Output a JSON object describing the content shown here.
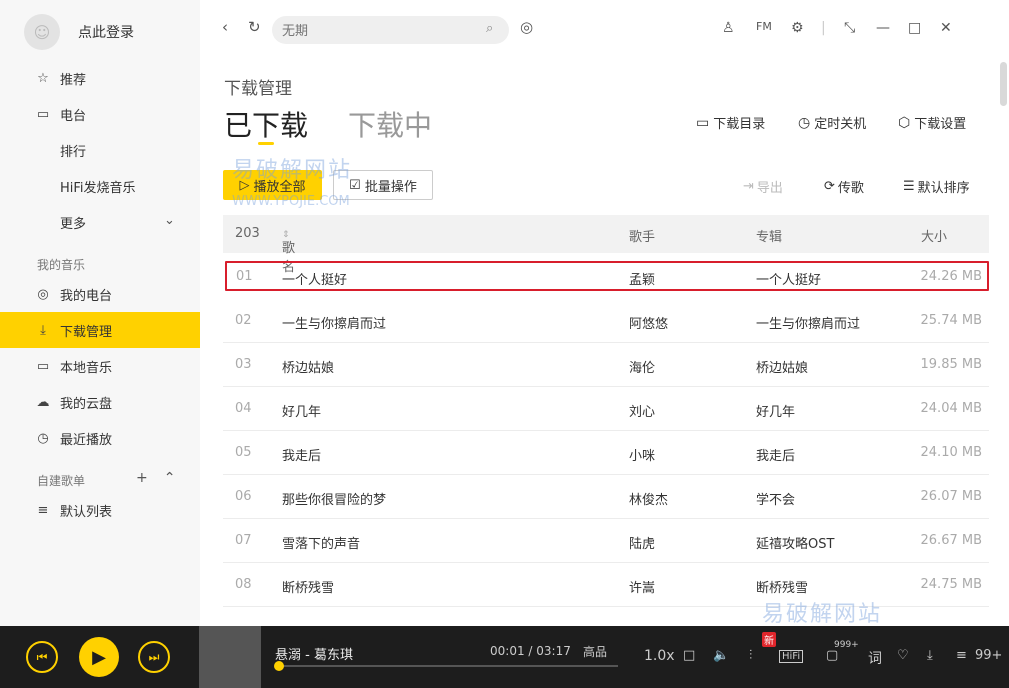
{
  "sidebar": {
    "login_label": "点此登录",
    "nav": [
      {
        "label": "推荐",
        "icon": "star-icon"
      },
      {
        "label": "电台",
        "icon": "radio-icon"
      },
      {
        "label": "排行"
      },
      {
        "label": "HiFi发烧音乐"
      },
      {
        "label": "更多"
      }
    ],
    "my_music_title": "我的音乐",
    "my_music": [
      {
        "label": "我的电台",
        "icon": "podcast-icon"
      },
      {
        "label": "下载管理",
        "icon": "download-icon",
        "active": true
      },
      {
        "label": "本地音乐",
        "icon": "monitor-icon"
      },
      {
        "label": "我的云盘",
        "icon": "cloud-icon"
      },
      {
        "label": "最近播放",
        "icon": "clock-icon"
      }
    ],
    "playlists_title": "自建歌单",
    "playlists": [
      {
        "label": "默认列表",
        "icon": "playlist-icon"
      }
    ]
  },
  "topbar": {
    "search_placeholder": "无期"
  },
  "page": {
    "breadcrumb": "下载管理",
    "tab_downloaded": "已下载",
    "tab_downloading": "下载中",
    "tool_dir": "下载目录",
    "tool_shutdown": "定时关机",
    "tool_settings": "下载设置",
    "play_all": "播放全部",
    "batch": "批量操作",
    "export": "导出",
    "transfer": "传歌",
    "sort": "默认排序"
  },
  "table": {
    "count": "203",
    "col_name": "歌名",
    "col_artist": "歌手",
    "col_album": "专辑",
    "col_size": "大小",
    "rows": [
      {
        "num": "01",
        "name": "一个人挺好",
        "artist": "孟颖",
        "album": "一个人挺好",
        "size": "24.26 MB"
      },
      {
        "num": "02",
        "name": "一生与你擦肩而过",
        "artist": "阿悠悠",
        "album": "一生与你擦肩而过",
        "size": "25.74 MB"
      },
      {
        "num": "03",
        "name": "桥边姑娘",
        "artist": "海伦",
        "album": "桥边姑娘",
        "size": "19.85 MB"
      },
      {
        "num": "04",
        "name": "好几年",
        "artist": "刘心",
        "album": "好几年",
        "size": "24.04 MB"
      },
      {
        "num": "05",
        "name": "我走后",
        "artist": "小咪",
        "album": "我走后",
        "size": "24.10 MB"
      },
      {
        "num": "06",
        "name": "那些你很冒险的梦",
        "artist": "林俊杰",
        "album": "学不会",
        "size": "26.07 MB"
      },
      {
        "num": "07",
        "name": "雪落下的声音",
        "artist": "陆虎",
        "album": "延禧攻略OST",
        "size": "26.67 MB"
      },
      {
        "num": "08",
        "name": "断桥残雪",
        "artist": "许嵩",
        "album": "断桥残雪",
        "size": "24.75 MB"
      }
    ]
  },
  "watermark": {
    "text": "易破解网站",
    "url": "WWW.YPOJIE.COM"
  },
  "player": {
    "song": "悬溺 - 葛东琪",
    "time": "00:01 / 03:17",
    "quality": "高品",
    "speed": "1.0x",
    "hifi": "HiFi",
    "new_badge": "新",
    "comments": "999+",
    "lyrics": "词",
    "list_count": "99+",
    "progress": 0.005
  }
}
